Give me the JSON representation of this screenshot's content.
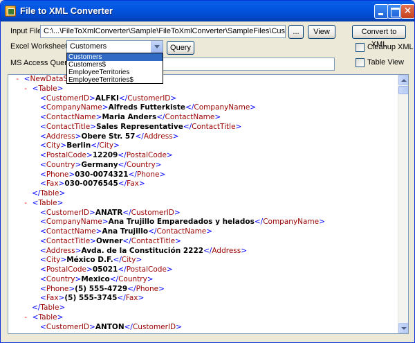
{
  "window": {
    "title": "File to XML Converter",
    "controls": [
      "minimize-icon",
      "maximize-icon",
      "close-icon"
    ]
  },
  "form": {
    "input_file_label": "Input File:",
    "input_file_value": "C:\\...\\FileToXmlConverter\\Sample\\FileToXmlConverter\\SampleFiles\\CustomerSample.xls",
    "browse_label": "...",
    "view_label": "View",
    "convert_label": "Convert to XML",
    "worksheet_label": "Excel Worksheet:",
    "worksheet_selected": "Customers",
    "worksheet_options": [
      "Customers",
      "Customers$",
      "EmployeeTerritories",
      "EmployeeTerritories$"
    ],
    "query_label": "Query",
    "ms_access_label": "MS Access Query:",
    "ms_access_value": "",
    "cleanup_label": "Cleanup XML",
    "cleanup_checked": false,
    "tableview_label": "Table View",
    "tableview_checked": false
  },
  "xml": {
    "lines": [
      {
        "indent": 0,
        "toggle": "-",
        "kind": "open",
        "tag": "NewDataSet"
      },
      {
        "indent": 1,
        "toggle": "-",
        "kind": "open",
        "tag": "Table"
      },
      {
        "indent": 2,
        "kind": "elem",
        "tag": "CustomerID",
        "value": "ALFKI"
      },
      {
        "indent": 2,
        "kind": "elem",
        "tag": "CompanyName",
        "value": "Alfreds Futterkiste"
      },
      {
        "indent": 2,
        "kind": "elem",
        "tag": "ContactName",
        "value": "Maria Anders"
      },
      {
        "indent": 2,
        "kind": "elem",
        "tag": "ContactTitle",
        "value": "Sales Representative"
      },
      {
        "indent": 2,
        "kind": "elem",
        "tag": "Address",
        "value": "Obere Str. 57"
      },
      {
        "indent": 2,
        "kind": "elem",
        "tag": "City",
        "value": "Berlin"
      },
      {
        "indent": 2,
        "kind": "elem",
        "tag": "PostalCode",
        "value": "12209"
      },
      {
        "indent": 2,
        "kind": "elem",
        "tag": "Country",
        "value": "Germany"
      },
      {
        "indent": 2,
        "kind": "elem",
        "tag": "Phone",
        "value": "030-0074321"
      },
      {
        "indent": 2,
        "kind": "elem",
        "tag": "Fax",
        "value": "030-0076545"
      },
      {
        "indent": 1,
        "kind": "close",
        "tag": "Table"
      },
      {
        "indent": 1,
        "toggle": "-",
        "kind": "open",
        "tag": "Table"
      },
      {
        "indent": 2,
        "kind": "elem",
        "tag": "CustomerID",
        "value": "ANATR"
      },
      {
        "indent": 2,
        "kind": "elem",
        "tag": "CompanyName",
        "value": "Ana Trujillo Emparedados y helados"
      },
      {
        "indent": 2,
        "kind": "elem",
        "tag": "ContactName",
        "value": "Ana Trujillo"
      },
      {
        "indent": 2,
        "kind": "elem",
        "tag": "ContactTitle",
        "value": "Owner"
      },
      {
        "indent": 2,
        "kind": "elem",
        "tag": "Address",
        "value": "Avda. de la Constitución 2222"
      },
      {
        "indent": 2,
        "kind": "elem",
        "tag": "City",
        "value": "México D.F."
      },
      {
        "indent": 2,
        "kind": "elem",
        "tag": "PostalCode",
        "value": "05021"
      },
      {
        "indent": 2,
        "kind": "elem",
        "tag": "Country",
        "value": "Mexico"
      },
      {
        "indent": 2,
        "kind": "elem",
        "tag": "Phone",
        "value": "(5) 555-4729"
      },
      {
        "indent": 2,
        "kind": "elem",
        "tag": "Fax",
        "value": "(5) 555-3745"
      },
      {
        "indent": 1,
        "kind": "close",
        "tag": "Table"
      },
      {
        "indent": 1,
        "toggle": "-",
        "kind": "open",
        "tag": "Table"
      },
      {
        "indent": 2,
        "kind": "elem",
        "tag": "CustomerID",
        "value": "ANTON"
      }
    ]
  },
  "colors": {
    "tag": "#990000",
    "bracket": "#0000FF",
    "toggle": "#FF0000",
    "selection": "#316AC5",
    "titlebar": "#0255E0"
  }
}
